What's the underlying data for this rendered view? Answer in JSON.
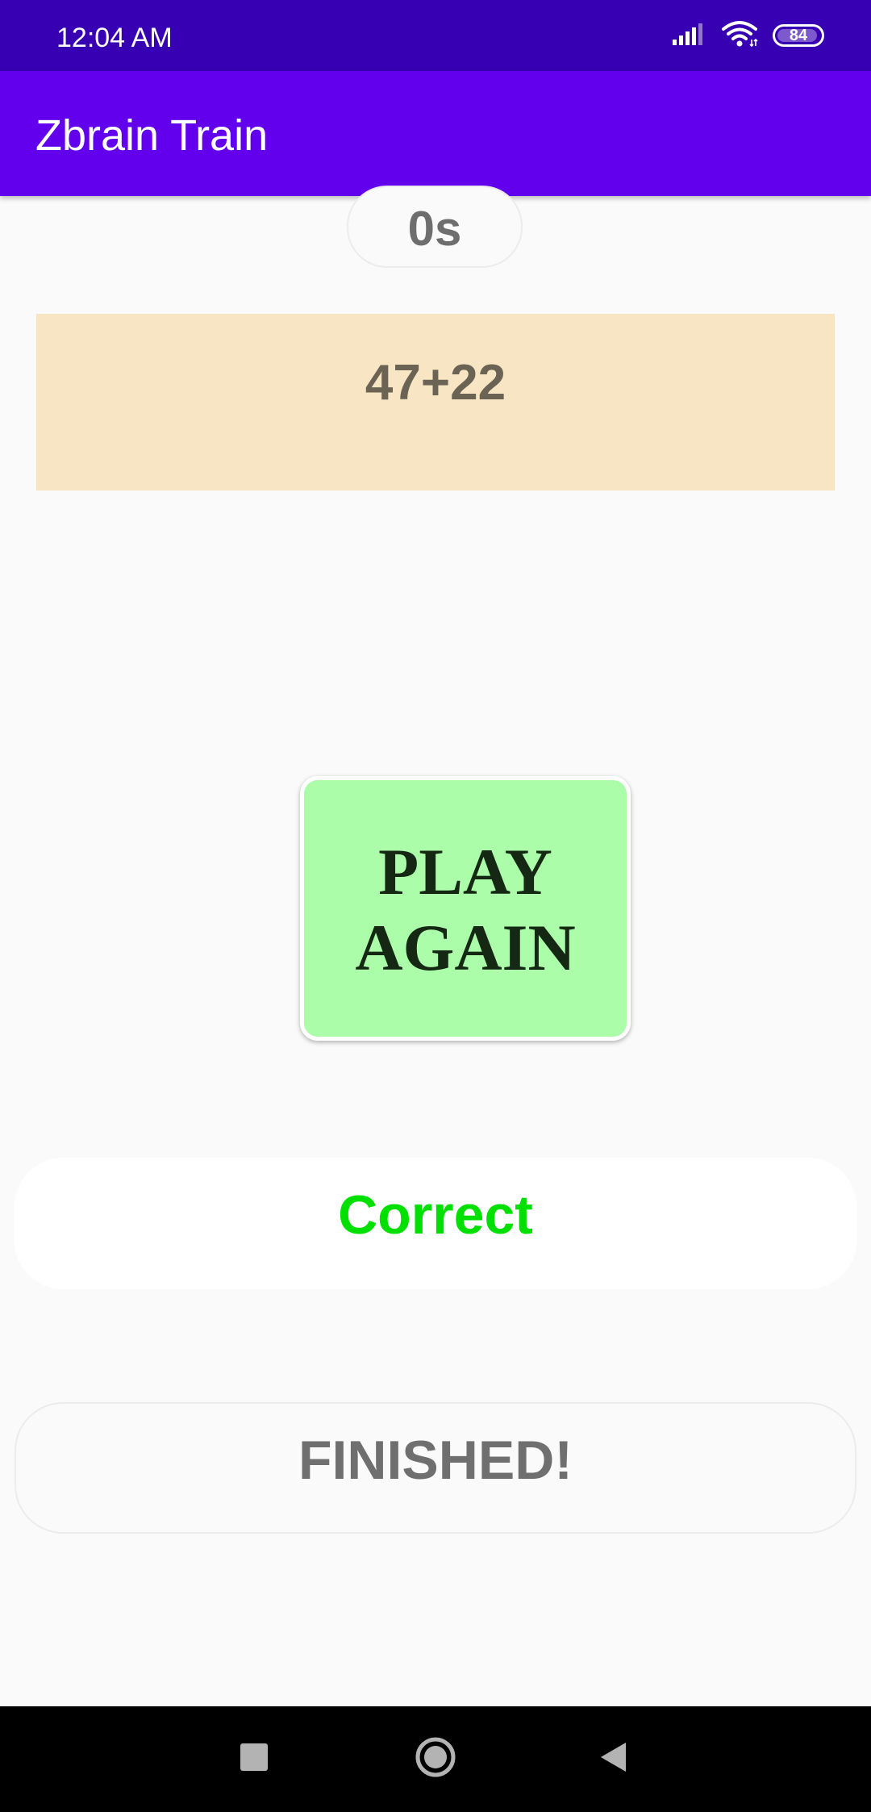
{
  "status_bar": {
    "time": "12:04 AM",
    "battery_level": "84",
    "icons": [
      "signal-icon",
      "wifi-icon",
      "battery-icon"
    ]
  },
  "app_bar": {
    "title": "Zbrain Train"
  },
  "game": {
    "timer": "0s",
    "question": "47+22",
    "play_again_label": "PLAY\nAGAIN",
    "result": "Correct",
    "status": "FINISHED!"
  },
  "colors": {
    "status_bar": "#3700b3",
    "app_bar": "#6200ee",
    "question_background": "#f8e5c3",
    "play_again_background": "#abfda9",
    "correct_text": "#00e000"
  },
  "nav_bar": {
    "buttons": [
      "recents-icon",
      "home-icon",
      "back-icon"
    ]
  }
}
